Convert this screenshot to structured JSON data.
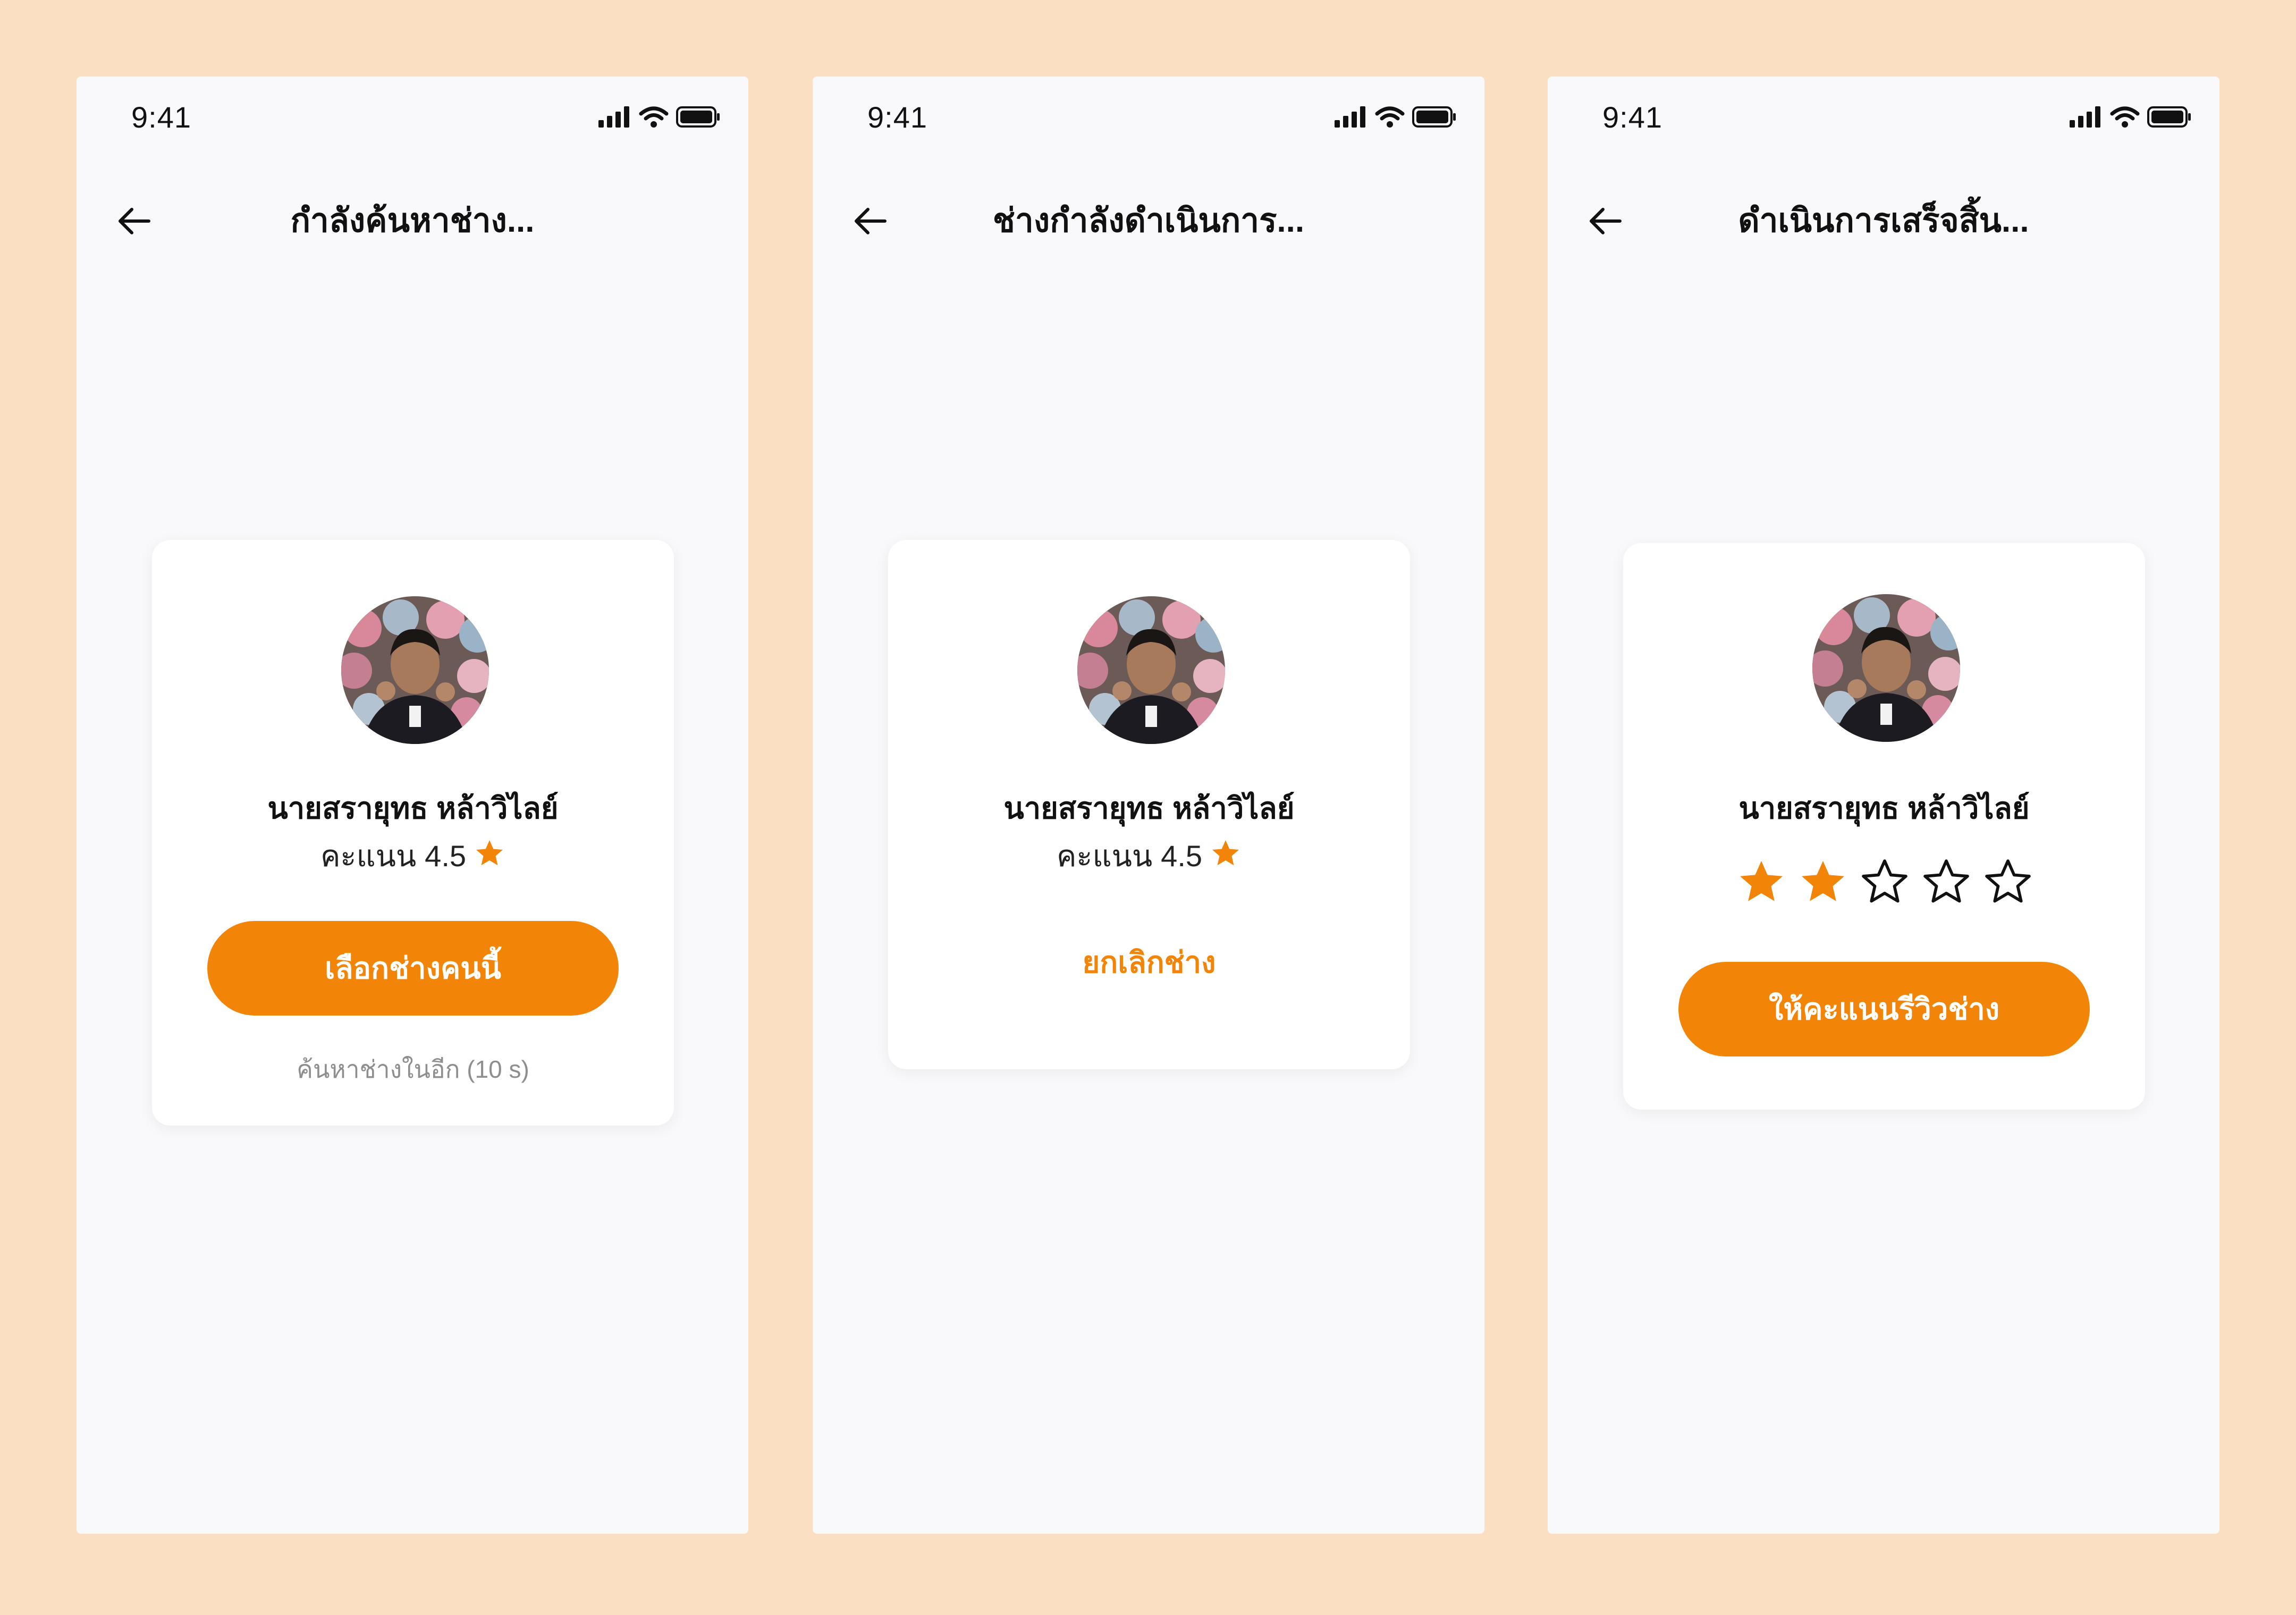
{
  "colors": {
    "page_background": "#FBDFC3",
    "screen_background": "#F9F8FA",
    "accent": "#F28407",
    "card": "#FFFFFF",
    "muted_text": "#8E8E8E"
  },
  "screens": [
    {
      "status_time": "9:41",
      "title": "กำลังค้นหาช่าง...",
      "technician": {
        "name": "นายสรายุทธ หล้าวิไลย์",
        "rating_label": "คะแนน",
        "rating_value": "4.5"
      },
      "primary_button": "เลือกช่างคนนี้",
      "countdown": "ค้นหาช่างในอีก (10 s)"
    },
    {
      "status_time": "9:41",
      "title": "ช่างกำลังดำเนินการ...",
      "technician": {
        "name": "นายสรายุทธ หล้าวิไลย์",
        "rating_label": "คะแนน",
        "rating_value": "4.5"
      },
      "cancel_link": "ยกเลิกช่าง"
    },
    {
      "status_time": "9:41",
      "title": "ดำเนินการเสร็จสิ้น...",
      "technician": {
        "name": "นายสรายุทธ หล้าวิไลย์"
      },
      "review_rating": {
        "selected": 2,
        "max": 5
      },
      "primary_button": "ให้คะแนนรีวิวช่าง"
    }
  ],
  "icons": {
    "back": "arrow-left-icon",
    "signal": "cellular-signal-icon",
    "wifi": "wifi-icon",
    "battery": "battery-icon",
    "star_filled": "star-filled-icon",
    "star_outline": "star-outline-icon",
    "avatar": "technician-avatar"
  }
}
